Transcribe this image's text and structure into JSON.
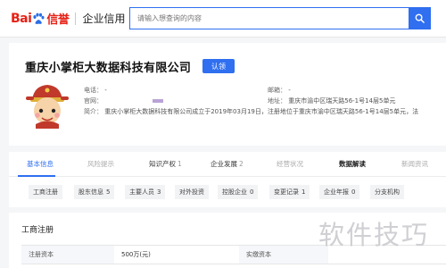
{
  "header": {
    "logo_bai": "Bai",
    "logo_du": "du",
    "logo_xin": "信誉",
    "logo_sub": "企业信用",
    "search_placeholder": "请输入想查询的内容"
  },
  "company": {
    "name": "重庆小掌柜大数据科技有限公司",
    "cert_label": "认领",
    "phone_label": "电话：",
    "phone_value": "-",
    "site_label": "官网：",
    "email_label": "邮箱：",
    "email_value": "-",
    "address_label": "地址：",
    "address_value": "重庆市渝中区瑞天路56-1号14层5单元",
    "intro_label": "简介：",
    "intro_value": "重庆小掌柜大数据科技有限公司成立于2019年03月19日，注册地位于重庆市渝中区瑞天路56-1号14层5单元，法"
  },
  "tabs": [
    {
      "label": "基本信息",
      "count": ""
    },
    {
      "label": "风险提示",
      "count": ""
    },
    {
      "label": "知识产权",
      "count": "1"
    },
    {
      "label": "企业发展",
      "count": "2"
    },
    {
      "label": "经营状况",
      "count": ""
    },
    {
      "label": "数据解读",
      "count": ""
    },
    {
      "label": "新闻资讯",
      "count": ""
    }
  ],
  "chips": [
    {
      "label": "工商注册",
      "count": ""
    },
    {
      "label": "股东信息",
      "count": "5"
    },
    {
      "label": "主要人员",
      "count": "3"
    },
    {
      "label": "对外投资",
      "count": ""
    },
    {
      "label": "控股企业",
      "count": "0"
    },
    {
      "label": "变更记录",
      "count": "1"
    },
    {
      "label": "企业年报",
      "count": "0"
    },
    {
      "label": "分支机构",
      "count": ""
    }
  ],
  "section": {
    "title": "工商注册",
    "row": {
      "label1": "注册资本",
      "value1": "500万(元)",
      "label2": "实缴资本"
    }
  },
  "watermark": "软件技巧",
  "colors": {
    "accent": "#2f6ff0",
    "logo_red": "#e62117",
    "logo_blue": "#2b6ee6"
  }
}
